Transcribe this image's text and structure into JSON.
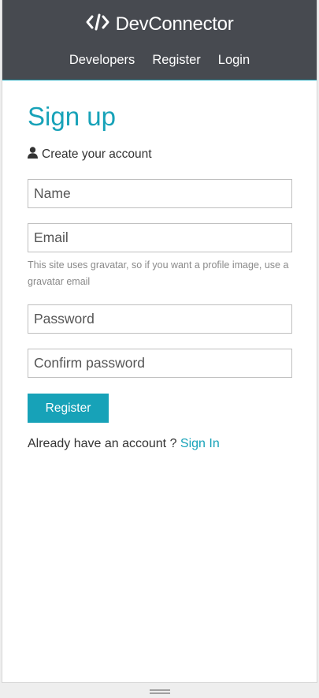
{
  "navbar": {
    "brand": "DevConnector",
    "brand_icon": "code-icon",
    "links": [
      "Developers",
      "Register",
      "Login"
    ]
  },
  "main": {
    "title": "Sign up",
    "lead": "Create your account",
    "lead_icon": "user-icon",
    "fields": {
      "name": {
        "placeholder": "Name",
        "value": ""
      },
      "email": {
        "placeholder": "Email",
        "value": ""
      },
      "email_help": "This site uses gravatar, so if you want a profile image, use a gravatar email",
      "password": {
        "placeholder": "Password",
        "value": ""
      },
      "confirm_password": {
        "placeholder": "Confirm password",
        "value": ""
      }
    },
    "submit_label": "Register",
    "signin_prompt": "Already have an account ?",
    "signin_link": "Sign In"
  },
  "colors": {
    "navbar_bg": "#474a50",
    "accent": "#17a2b8",
    "text": "#333333"
  }
}
